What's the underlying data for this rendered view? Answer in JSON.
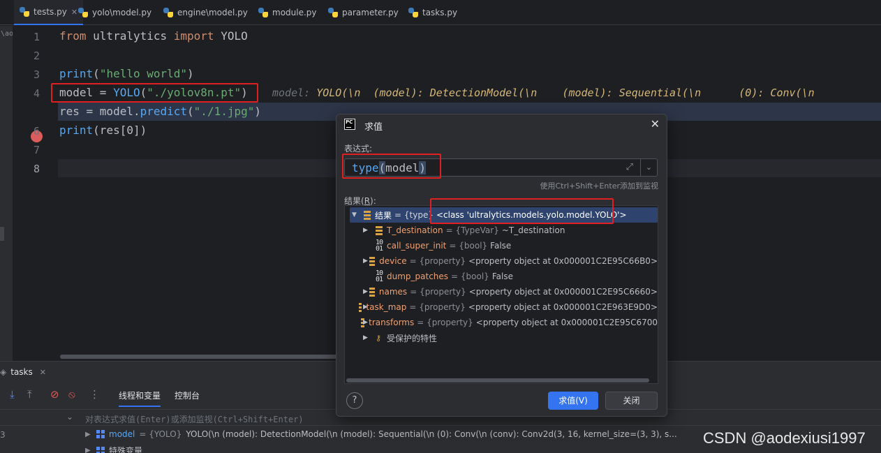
{
  "tabs": [
    {
      "label": "tests.py",
      "active": true
    },
    {
      "label": "yolo\\model.py"
    },
    {
      "label": "engine\\model.py"
    },
    {
      "label": "module.py"
    },
    {
      "label": "parameter.py"
    },
    {
      "label": "tasks.py"
    }
  ],
  "editor": {
    "side_snippet": "\\ao",
    "line_numbers": [
      "1",
      "2",
      "3",
      "4",
      "5",
      "6",
      "7",
      "8"
    ],
    "lines": {
      "l1": {
        "kw1": "from",
        "mod": " ultralytics ",
        "kw2": "import",
        "cls": " YOLO"
      },
      "l3": {
        "fn": "print",
        "open": "(",
        "str": "\"hello world\"",
        "close": ")"
      },
      "l4": {
        "var": "model = ",
        "fn": "YOLO",
        "open": "(",
        "str": "\"./yolov8n.pt\"",
        "close": ")"
      },
      "l5": {
        "var": "res = model.",
        "fn": "predict",
        "open": "(",
        "str": "\"./1.jpg\"",
        "close": ")"
      },
      "l6": {
        "fn": "print",
        "rest": "(res[0])"
      }
    },
    "inline_hint_label": "model:",
    "inline_hint_value": "YOLO(\\n  (model): DetectionModel(\\n    (model): Sequential(\\n      (0): Conv(\\n"
  },
  "dialog": {
    "title": "求值",
    "expression_label": "表达式:",
    "expression": {
      "fn": "type",
      "open": "(",
      "arg": "model",
      "close": ")"
    },
    "hint": "使用Ctrl+Shift+Enter添加到监视",
    "result_label_prefix": "结果(",
    "result_label_mnemonic": "R",
    "result_label_suffix": "):",
    "tree": [
      {
        "name": "结果",
        "type": "= {type}",
        "value": "<class 'ultralytics.models.yolo.model.YOLO'>",
        "icon": "stack",
        "expand": "down",
        "selected": true
      },
      {
        "name": "T_destination",
        "type": "= {TypeVar}",
        "value": "~T_destination",
        "icon": "stack",
        "expand": "right"
      },
      {
        "name": "call_super_init",
        "type": "= {bool}",
        "value": "False",
        "icon": "bool",
        "expand": "none"
      },
      {
        "name": "device",
        "type": "= {property}",
        "value": "<property object at 0x000001C2E95C66B0>",
        "icon": "stack",
        "expand": "right"
      },
      {
        "name": "dump_patches",
        "type": "= {bool}",
        "value": "False",
        "icon": "bool",
        "expand": "none"
      },
      {
        "name": "names",
        "type": "= {property}",
        "value": "<property object at 0x000001C2E95C6660>",
        "icon": "stack",
        "expand": "right"
      },
      {
        "name": "task_map",
        "type": "= {property}",
        "value": "<property object at 0x000001C2E963E9D0>",
        "icon": "stack",
        "expand": "right"
      },
      {
        "name": "transforms",
        "type": "= {property}",
        "value": "<property object at 0x000001C2E95C6700",
        "icon": "stack",
        "expand": "right"
      },
      {
        "name": "受保护的特性",
        "type": "",
        "value": "",
        "icon": "key",
        "expand": "right"
      }
    ],
    "help": "?",
    "evaluate_button": "求值(V)",
    "close_button": "关闭"
  },
  "debug": {
    "title": "tasks",
    "tab_threads": "线程和变量",
    "tab_console": "控制台",
    "eval_placeholder": "对表达式求值(Enter)或添加监视(Ctrl+Shift+Enter)",
    "left_digit": "3",
    "var_row": {
      "name": "model",
      "type": "= {YOLO}",
      "value": "YOLO(\\n  (model): DetectionModel(\\n    (model): Sequential(\\n      (0): Conv(\\n        (conv): Conv2d(3, 16, kernel_size=(3, 3), s..."
    },
    "special_vars": "特殊变量"
  },
  "watermark": "CSDN @aodexiusi1997",
  "colors": {
    "accent": "#3574f0",
    "highlight_box": "#e02020",
    "breakpoint": "#db5c5c"
  }
}
